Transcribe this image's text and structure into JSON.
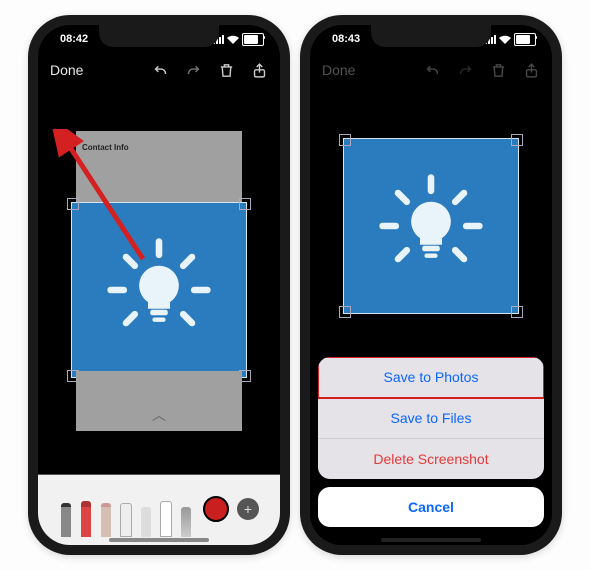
{
  "left": {
    "status": {
      "time": "08:42"
    },
    "toolbar": {
      "done": "Done",
      "icons": [
        "undo-icon",
        "redo-icon",
        "trash-icon",
        "share-icon"
      ]
    },
    "preview": {
      "contact_info": "Contact Info"
    },
    "dock": {
      "tools": [
        "pen",
        "marker",
        "pencil",
        "eraser",
        "lasso",
        "ruler",
        "crayon"
      ],
      "add": "+"
    }
  },
  "right": {
    "status": {
      "time": "08:43"
    },
    "toolbar": {
      "done": "Done",
      "icons": [
        "undo-icon",
        "redo-icon",
        "trash-icon",
        "share-icon"
      ]
    },
    "sheet": {
      "save_photos": "Save to Photos",
      "save_files": "Save to Files",
      "delete": "Delete Screenshot",
      "cancel": "Cancel"
    }
  },
  "colors": {
    "accent_blue": "#2b7bbf",
    "action_blue": "#0a66ff",
    "destructive": "#e63939",
    "highlight": "#d42020"
  }
}
